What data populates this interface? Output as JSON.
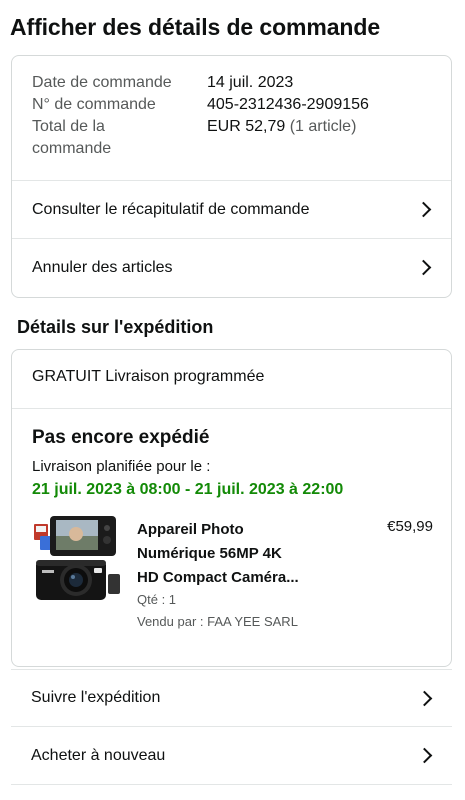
{
  "page": {
    "title": "Afficher des détails de commande"
  },
  "order": {
    "date_label": "Date de commande",
    "date_value": "14 juil. 2023",
    "number_label": "N° de commande",
    "number_value": "405-2312436-2909156",
    "total_label": "Total de la commande",
    "total_value": "EUR 52,79",
    "total_count": "(1 article)",
    "summary_link": "Consulter le récapitulatif de commande",
    "cancel_link": "Annuler des articles"
  },
  "shipping": {
    "section_title": "Détails sur l'expédition",
    "type": "GRATUIT Livraison programmée",
    "status": "Pas encore expédié",
    "planned_label": "Livraison planifiée pour le :",
    "window": "21 juil. 2023 à 08:00 - 21 juil. 2023 à 22:00",
    "item": {
      "title_line1": "Appareil Photo",
      "title_line2": "Numérique 56MP 4K",
      "title_line3": "HD Compact Caméra...",
      "price": "€59,99",
      "qty": "Qté : 1",
      "seller": "Vendu par : FAA YEE SARL"
    }
  },
  "actions": {
    "track": "Suivre l'expédition",
    "buy_again": "Acheter à nouveau"
  },
  "colors": {
    "text": "#0f1111",
    "muted": "#565959",
    "delivery_green": "#138a07",
    "border": "#d5d9d9"
  }
}
